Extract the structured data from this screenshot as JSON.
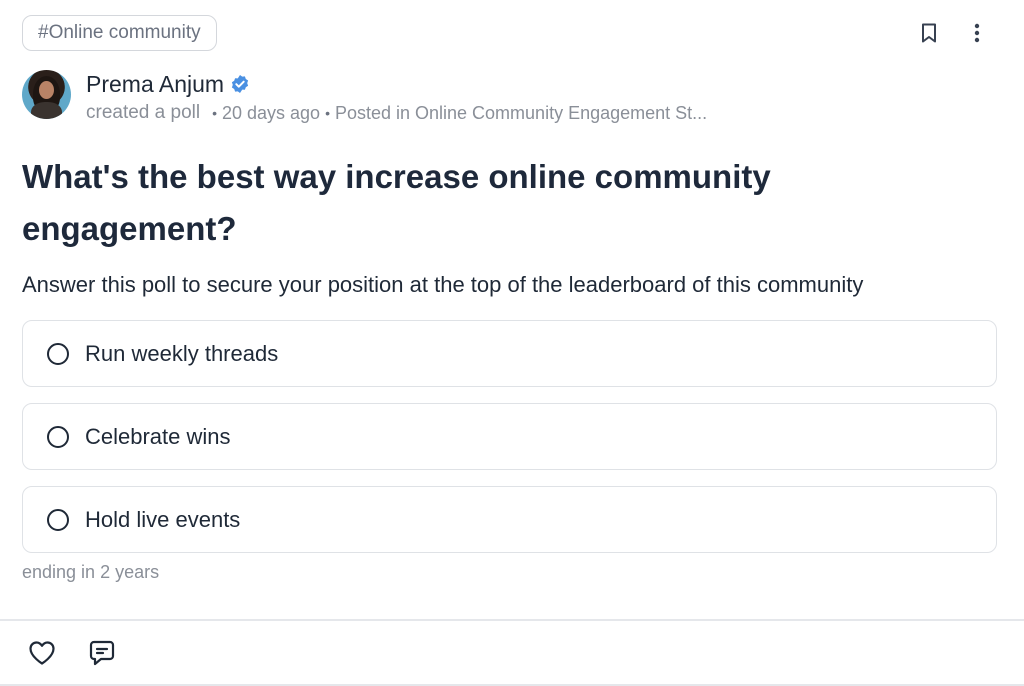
{
  "post": {
    "tag": "#Online community",
    "author": {
      "name": "Prema Anjum",
      "verified": true,
      "action": "created a poll",
      "time_ago": "20 days ago",
      "posted_in": "Posted in Online Community Engagement St..."
    },
    "question": "What's the best way increase online community engagement?",
    "description": "Answer this poll to secure your position at the top of the leaderboard of this community",
    "options": [
      {
        "label": "Run weekly threads"
      },
      {
        "label": "Celebrate wins"
      },
      {
        "label": "Hold live events"
      }
    ],
    "ending": "ending in 2 years"
  },
  "icons": {
    "bookmark": "bookmark-icon",
    "more": "more-vertical-icon",
    "verified": "verified-badge-icon",
    "like": "heart-icon",
    "comment": "comment-icon"
  },
  "colors": {
    "verified": "#4a90e2",
    "text": "#1f2937",
    "muted": "#8a8f98",
    "border": "#dfe2e6"
  }
}
